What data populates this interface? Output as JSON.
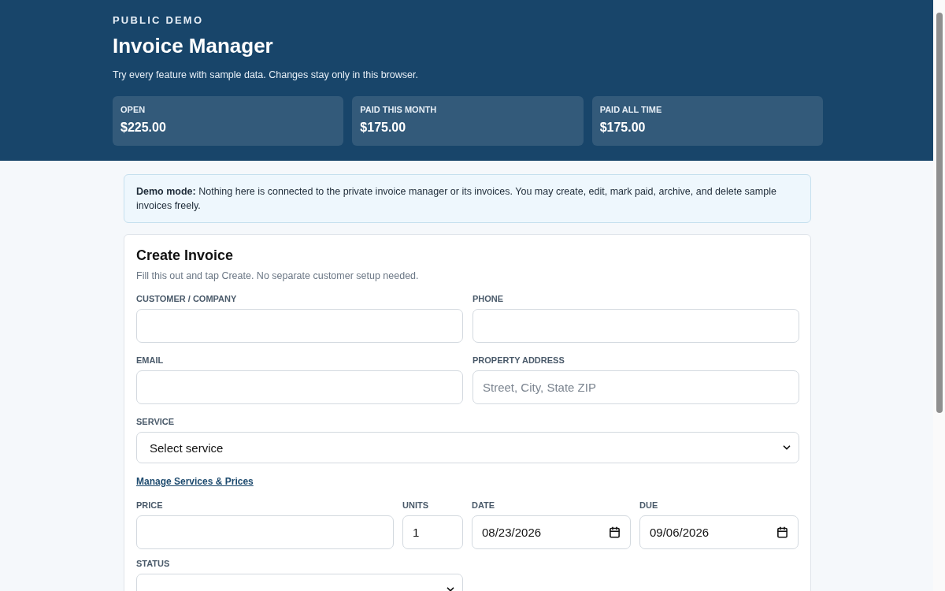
{
  "header": {
    "eyebrow": "PUBLIC DEMO",
    "title": "Invoice Manager",
    "subtitle": "Try every feature with sample data. Changes stay only in this browser.",
    "stats": [
      {
        "label": "OPEN",
        "value": "$225.00"
      },
      {
        "label": "PAID THIS MONTH",
        "value": "$175.00"
      },
      {
        "label": "PAID ALL TIME",
        "value": "$175.00"
      }
    ]
  },
  "notice": "**Demo mode:** Nothing here is connected to the private invoice manager or its invoices. You may create, edit, mark paid, archive, and delete sample invoices freely.",
  "form": {
    "title": "Create Invoice",
    "subtitle": "Fill this out and tap Create. No separate customer setup needed.",
    "rows": [
      [
        {
          "label": "CUSTOMER / COMPANY",
          "kind": "text"
        },
        {
          "label": "PHONE",
          "kind": "text"
        }
      ],
      [
        {
          "label": "EMAIL",
          "kind": "text"
        },
        {
          "label": "PROPERTY ADDRESS",
          "kind": "text",
          "placeholder": "Street, City, State ZIP"
        }
      ],
      [
        {
          "label": "SERVICE",
          "kind": "select",
          "value": "Select service"
        }
      ]
    ],
    "link": "Manage Services & Prices",
    "detail_row": [
      {
        "label": "PRICE",
        "kind": "text"
      },
      {
        "label": "UNITS",
        "kind": "text",
        "value": "1"
      },
      {
        "label": "DATE",
        "kind": "date",
        "value": "08/23/2026"
      },
      {
        "label": "DUE",
        "kind": "date",
        "value": "09/06/2026"
      }
    ],
    "status": {
      "label": "STATUS",
      "kind": "select"
    }
  }
}
